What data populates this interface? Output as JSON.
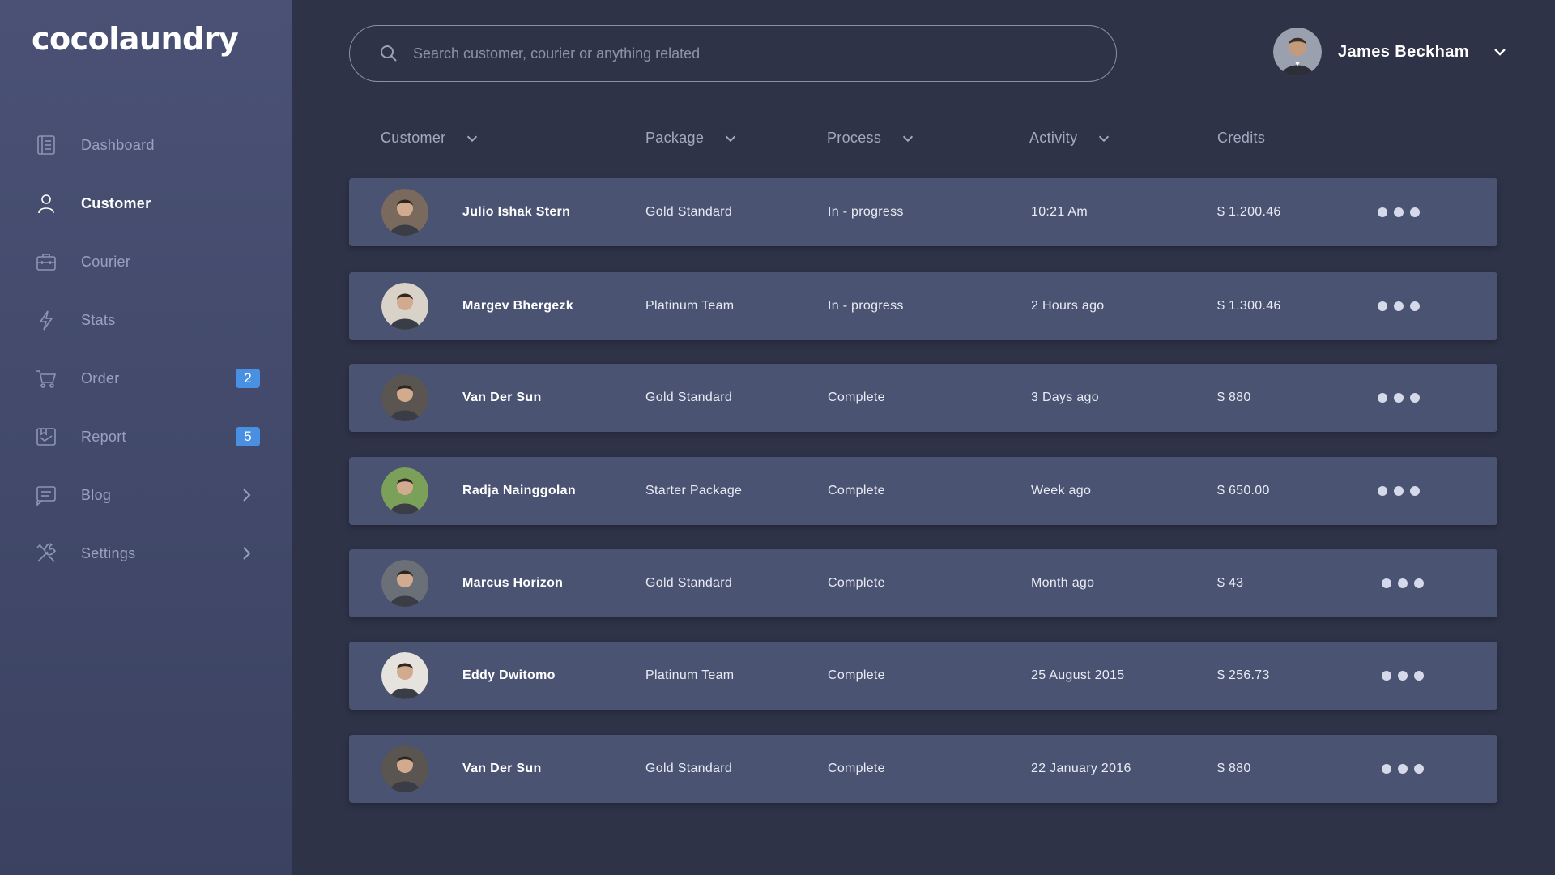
{
  "app": {
    "logo": "cocolaundry"
  },
  "sidebar": {
    "items": [
      {
        "label": "Dashboard",
        "icon": "dashboard-icon",
        "active": false
      },
      {
        "label": "Customer",
        "icon": "user-icon",
        "active": true
      },
      {
        "label": "Courier",
        "icon": "briefcase-icon",
        "active": false
      },
      {
        "label": "Stats",
        "icon": "lightning-icon",
        "active": false
      },
      {
        "label": "Order",
        "icon": "cart-icon",
        "active": false,
        "badge": "2"
      },
      {
        "label": "Report",
        "icon": "report-icon",
        "active": false,
        "badge": "5"
      },
      {
        "label": "Blog",
        "icon": "blog-icon",
        "active": false,
        "chevron": true
      },
      {
        "label": "Settings",
        "icon": "tools-icon",
        "active": false,
        "chevron": true
      }
    ]
  },
  "header": {
    "search_placeholder": "Search customer, courier or anything related",
    "user_name": "James Beckham"
  },
  "table": {
    "columns": [
      "Customer",
      "Package",
      "Process",
      "Activity",
      "Credits"
    ],
    "rows": [
      {
        "name": "Julio Ishak Stern",
        "package": "Gold Standard",
        "process": "In - progress",
        "activity": "10:21 Am",
        "credits": "$ 1.200.46",
        "avatar_color": "#7a6a5e"
      },
      {
        "name": "Margev Bhergezk",
        "package": "Platinum Team",
        "process": "In - progress",
        "activity": "2 Hours ago",
        "credits": "$ 1.300.46",
        "avatar_color": "#d9d2c9"
      },
      {
        "name": "Van Der Sun",
        "package": "Gold Standard",
        "process": "Complete",
        "activity": "3 Days ago",
        "credits": "$ 880",
        "avatar_color": "#5a5550"
      },
      {
        "name": "Radja Nainggolan",
        "package": "Starter Package",
        "process": "Complete",
        "activity": "Week ago",
        "credits": "$ 650.00",
        "avatar_color": "#7aa05a"
      },
      {
        "name": "Marcus Horizon",
        "package": "Gold Standard",
        "process": "Complete",
        "activity": "Month ago",
        "credits": "$ 43",
        "avatar_color": "#6b6f78"
      },
      {
        "name": "Eddy Dwitomo",
        "package": "Platinum Team",
        "process": "Complete",
        "activity": "25 August 2015",
        "credits": "$ 256.73",
        "avatar_color": "#e6e3de"
      },
      {
        "name": "Van Der Sun",
        "package": "Gold Standard",
        "process": "Complete",
        "activity": "22 January 2016",
        "credits": "$ 880",
        "avatar_color": "#5a5550"
      }
    ]
  },
  "colors": {
    "background": "#2e3348",
    "sidebar": "#434a6c",
    "row": "#4b5373",
    "badge": "#4a90e2"
  }
}
